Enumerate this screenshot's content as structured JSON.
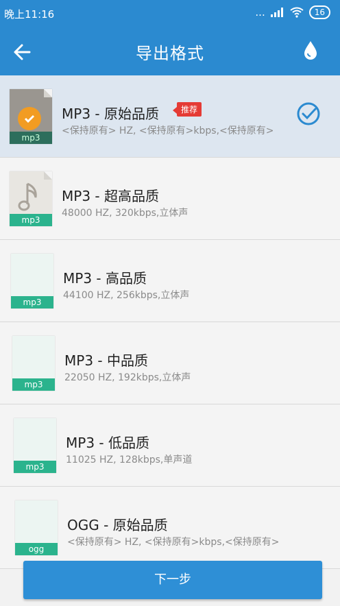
{
  "status": {
    "time": "晚上11:16",
    "signal_text": "...",
    "battery": "16"
  },
  "appbar": {
    "title": "导出格式",
    "back_icon": "back-arrow-icon",
    "action_icon": "water-drop-icon"
  },
  "formats": [
    {
      "title": "MP3 - 原始品质",
      "detail": "<保持原有> HZ, <保持原有>kbps,<保持原有>",
      "ext": "mp3",
      "selected": true,
      "badge": "推荐"
    },
    {
      "title": "MP3 - 超高品质",
      "detail": "48000 HZ, 320kbps,立体声",
      "ext": "mp3",
      "selected": false
    },
    {
      "title": "MP3 - 高品质",
      "detail": "44100 HZ, 256kbps,立体声",
      "ext": "mp3",
      "selected": false
    },
    {
      "title": "MP3 - 中品质",
      "detail": "22050 HZ, 192kbps,立体声",
      "ext": "mp3",
      "selected": false
    },
    {
      "title": "MP3 - 低品质",
      "detail": "11025 HZ, 128kbps,单声道",
      "ext": "mp3",
      "selected": false
    },
    {
      "title": "OGG - 原始品质",
      "detail": "<保持原有> HZ, <保持原有>kbps,<保持原有>",
      "ext": "ogg",
      "selected": false
    }
  ],
  "footer": {
    "next_label": "下一步"
  },
  "colors": {
    "primary": "#2b8ad0",
    "accent_green": "#2bb38d",
    "badge_red": "#e53b35",
    "check_orange": "#f29c22"
  }
}
